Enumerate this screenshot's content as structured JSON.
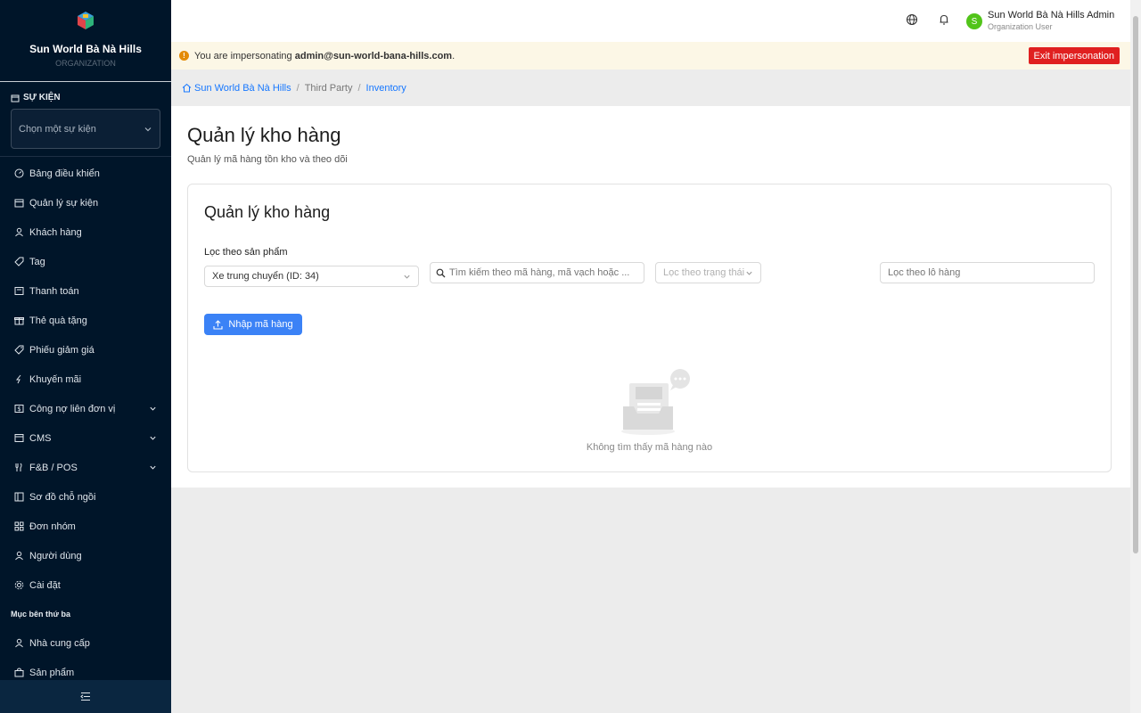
{
  "sidebar": {
    "brand_name": "Sun World Bà Nà Hills",
    "brand_sub": "ORGANIZATION",
    "event_section_label": "SỰ KIỆN",
    "event_select_placeholder": "Chọn một sự kiện",
    "items": [
      {
        "label": "Bảng điều khiển",
        "icon": "dashboard-icon"
      },
      {
        "label": "Quản lý sự kiện",
        "icon": "calendar-icon"
      },
      {
        "label": "Khách hàng",
        "icon": "user-icon"
      },
      {
        "label": "Tag",
        "icon": "tag-icon"
      },
      {
        "label": "Thanh toán",
        "icon": "payment-icon"
      },
      {
        "label": "Thẻ quà tặng",
        "icon": "gift-icon"
      },
      {
        "label": "Phiếu giảm giá",
        "icon": "coupon-icon"
      },
      {
        "label": "Khuyến mãi",
        "icon": "lightning-icon"
      },
      {
        "label": "Công nợ liên đơn vị",
        "icon": "debt-icon"
      },
      {
        "label": "CMS",
        "icon": "cms-icon"
      },
      {
        "label": "F&B / POS",
        "icon": "food-icon"
      },
      {
        "label": "Sơ đồ chỗ ngồi",
        "icon": "seating-icon"
      },
      {
        "label": "Đơn nhóm",
        "icon": "grid-icon"
      },
      {
        "label": "Người dùng",
        "icon": "person-icon"
      },
      {
        "label": "Cài đặt",
        "icon": "settings-icon"
      }
    ],
    "group_label": "Mục bên thứ ba",
    "third_party_items": [
      {
        "label": "Nhà cung cấp",
        "icon": "supplier-icon"
      },
      {
        "label": "Sản phẩm",
        "icon": "product-icon"
      }
    ]
  },
  "header": {
    "user_name": "Sun World Bà Nà Hills Admin",
    "user_role": "Organization User",
    "avatar_letter": "S"
  },
  "impersonation": {
    "prefix": "You are impersonating ",
    "email": "admin@sun-world-bana-hills.com",
    "suffix": ".",
    "exit_label": "Exit impersonation"
  },
  "breadcrumb": {
    "home": "Sun World Bà Nà Hills",
    "middle": "Third Party",
    "current": "Inventory"
  },
  "page": {
    "title": "Quản lý kho hàng",
    "subtitle": "Quản lý mã hàng tồn kho và theo dõi"
  },
  "card": {
    "title": "Quản lý kho hàng",
    "filter_label": "Lọc theo sản phẩm",
    "product_selected": "Xe trung chuyển (ID: 34)",
    "search_placeholder": "Tìm kiếm theo mã hàng, mã vạch hoặc ...",
    "status_placeholder": "Lọc theo trạng thái",
    "batch_placeholder": "Lọc theo lô hàng",
    "import_label": "Nhập mã hàng",
    "empty_text": "Không tìm thấy mã hàng nào"
  },
  "colors": {
    "sidebar_bg": "#001529",
    "accent": "#1677ff",
    "button_primary": "#3b82f6",
    "danger": "#e02020",
    "banner_bg": "#fcf7e6"
  }
}
